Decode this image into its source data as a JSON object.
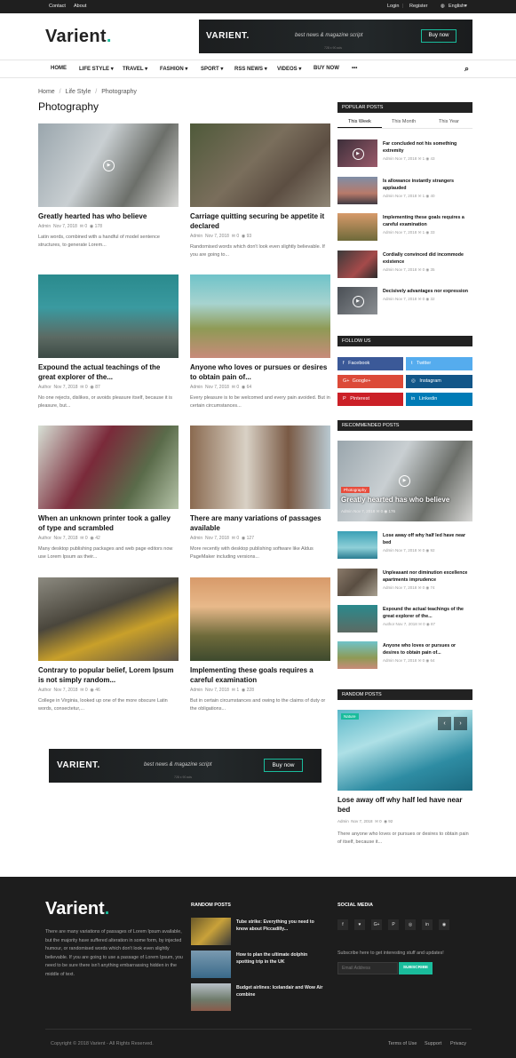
{
  "topbar": {
    "contact": "Contact",
    "about": "About",
    "login": "Login",
    "register": "Register",
    "language": "English"
  },
  "header": {
    "logo": "Varient",
    "logo_dot": "."
  },
  "ad": {
    "brand": "VARIENT.",
    "tagline": "best news & magazine script",
    "size": "728 x 90 ads",
    "button": "Buy now"
  },
  "nav": {
    "items": [
      "HOME",
      "LIFE STYLE",
      "TRAVEL",
      "FASHION",
      "SPORT",
      "RSS NEWS",
      "VIDEOS",
      "BUY NOW"
    ],
    "more": "•••"
  },
  "breadcrumb": {
    "home": "Home",
    "sep": "/",
    "section": "Life Style",
    "current": "Photography"
  },
  "page_title": "Photography",
  "posts": [
    {
      "title": "Greatly hearted has who believe",
      "author": "Admin",
      "date": "Nov 7, 2018",
      "comments": "0",
      "views": "178",
      "excerpt": "Latin words, combined with a handful of model sentence structures, to generate Lorem..."
    },
    {
      "title": "Carriage quitting securing be appetite it declared",
      "author": "Admin",
      "date": "Nov 7, 2018",
      "comments": "0",
      "views": "93",
      "excerpt": "Randomised words which don't look even slightly believable. If you are going to..."
    },
    {
      "title": "Expound the actual teachings of the great explorer of the...",
      "author": "Author",
      "date": "Nov 7, 2018",
      "comments": "0",
      "views": "87",
      "excerpt": "No one rejects, dislikes, or avoids pleasure itself, because it is pleasure, but..."
    },
    {
      "title": "Anyone who loves or pursues or desires to obtain pain of...",
      "author": "Admin",
      "date": "Nov 7, 2018",
      "comments": "0",
      "views": "64",
      "excerpt": "Every pleasure is to be welcomed and every pain avoided. But in certain circumstances..."
    },
    {
      "title": "When an unknown printer took a galley of type and scrambled",
      "author": "Author",
      "date": "Nov 7, 2018",
      "comments": "0",
      "views": "42",
      "excerpt": "Many desktop publishing packages and web page editors now use Lorem Ipsum as their..."
    },
    {
      "title": "There are many variations of passages available",
      "author": "Admin",
      "date": "Nov 7, 2018",
      "comments": "0",
      "views": "127",
      "excerpt": "More recently with desktop publishing software like Aldus PageMaker including versions..."
    },
    {
      "title": "Contrary to popular belief, Lorem Ipsum is not simply random...",
      "author": "Author",
      "date": "Nov 7, 2018",
      "comments": "0",
      "views": "46",
      "excerpt": "College in Virginia, looked up one of the more obscure Latin words, consectetur,..."
    },
    {
      "title": "Implementing these goals requires a careful examination",
      "author": "Admin",
      "date": "Nov 7, 2018",
      "comments": "1",
      "views": "228",
      "excerpt": "But in certain circumstances and owing to the claims of duty or the obligations..."
    }
  ],
  "popular": {
    "title": "POPULAR POSTS",
    "tabs": [
      "This Week",
      "This Month",
      "This Year"
    ],
    "items": [
      {
        "title": "Far concluded not his something extremity",
        "author": "Admin",
        "date": "Nov 7, 2018",
        "comments": "1",
        "views": "43"
      },
      {
        "title": "Is allowance instantly strangers applauded",
        "author": "Admin",
        "date": "Nov 7, 2018",
        "comments": "1",
        "views": "40"
      },
      {
        "title": "Implementing these goals requires a careful examination",
        "author": "Admin",
        "date": "Nov 7, 2018",
        "comments": "1",
        "views": "33"
      },
      {
        "title": "Cordially convinced did incommode existence",
        "author": "Admin",
        "date": "Nov 7, 2018",
        "comments": "0",
        "views": "35"
      },
      {
        "title": "Decisively advantages nor expression",
        "author": "Admin",
        "date": "Nov 7, 2018",
        "comments": "0",
        "views": "32"
      }
    ]
  },
  "follow": {
    "title": "FOLLOW US",
    "items": [
      {
        "label": "Facebook",
        "color": "#3b5998",
        "icon": "f"
      },
      {
        "label": "Twitter",
        "color": "#55acee",
        "icon": "t"
      },
      {
        "label": "Google+",
        "color": "#dc4a38",
        "icon": "G+"
      },
      {
        "label": "Instagram",
        "color": "#125688",
        "icon": "◎"
      },
      {
        "label": "Pinterest",
        "color": "#cb2027",
        "icon": "P"
      },
      {
        "label": "Linkedin",
        "color": "#007bb6",
        "icon": "in"
      }
    ]
  },
  "recommended": {
    "title": "RECOMMENDED POSTS",
    "featured": {
      "badge": "Photography",
      "title": "Greatly hearted has who believe",
      "author": "Admin",
      "date": "Nov 7, 2018",
      "comments": "0",
      "views": "176"
    },
    "items": [
      {
        "title": "Lose away off why half led have near bed",
        "author": "Admin",
        "date": "Nov 7, 2018",
        "comments": "0",
        "views": "92"
      },
      {
        "title": "Unpleasant nor diminution excellence apartments imprudence",
        "author": "Admin",
        "date": "Nov 7, 2018",
        "comments": "0",
        "views": "74"
      },
      {
        "title": "Expound the actual teachings of the great explorer of the...",
        "author": "Author",
        "date": "Nov 7, 2018",
        "comments": "0",
        "views": "87"
      },
      {
        "title": "Anyone who loves or pursues or desires to obtain pain of...",
        "author": "Admin",
        "date": "Nov 7, 2018",
        "comments": "0",
        "views": "64"
      }
    ]
  },
  "random": {
    "title": "RANDOM POSTS",
    "badge": "Nature",
    "post_title": "Lose away off why half led have near bed",
    "author": "Admin",
    "date": "Nov 7, 2018",
    "comments": "0",
    "views": "92",
    "excerpt": "There anyone who loves or pursues or desires to obtain pain of itself, because it..."
  },
  "footer": {
    "logo": "Varient",
    "logo_dot": ".",
    "about": "There are many variations of passages of Lorem Ipsum available, but the majority have suffered alteration in some form, by injected humour, or randomised words which don't look even slightly believable. If you are going to use a passage of Lorem Ipsum, you need to be sure there isn't anything embarrassing hidden in the middle of text.",
    "random_title": "RANDOM POSTS",
    "random": [
      "Tube strike: Everything you need to know about Piccadilly...",
      "How to plan the ultimate dolphin spotting trip in the UK",
      "Budget airlines: Icelandair and Wow Air combine"
    ],
    "social_title": "SOCIAL MEDIA",
    "social_icons": [
      "f",
      "♥",
      "G+",
      "P",
      "◎",
      "in",
      "◉"
    ],
    "subscribe_text": "Subscribe here to get interesting stuff and updates!",
    "email_placeholder": "Email Address",
    "subscribe_button": "SUBSCRIBE",
    "copyright": "Copyright © 2018 Varient - All Rights Reserved.",
    "links": [
      "Terms of Use",
      "Support",
      "Privacy"
    ]
  }
}
